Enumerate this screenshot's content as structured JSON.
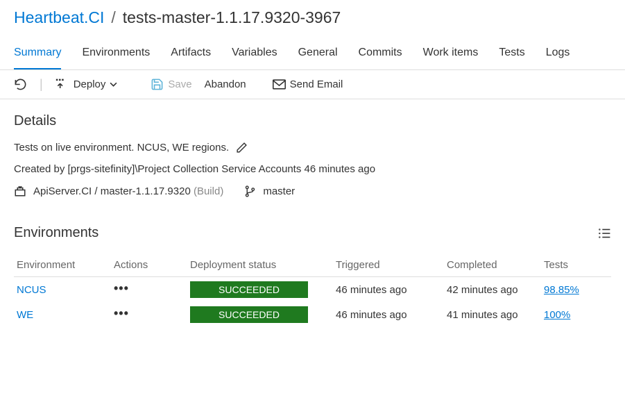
{
  "breadcrumb": {
    "pipeline": "Heartbeat.CI",
    "separator": "/",
    "release": "tests-master-1.1.17.9320-3967"
  },
  "tabs": [
    {
      "label": "Summary",
      "active": true
    },
    {
      "label": "Environments"
    },
    {
      "label": "Artifacts"
    },
    {
      "label": "Variables"
    },
    {
      "label": "General"
    },
    {
      "label": "Commits"
    },
    {
      "label": "Work items"
    },
    {
      "label": "Tests"
    },
    {
      "label": "Logs"
    }
  ],
  "toolbar": {
    "refresh": "",
    "deploy": "Deploy",
    "save": "Save",
    "abandon": "Abandon",
    "sendEmail": "Send Email"
  },
  "details": {
    "heading": "Details",
    "description": "Tests on live environment. NCUS, WE regions.",
    "createdByLine": "Created by [prgs-sitefinity]\\Project Collection Service Accounts 46 minutes ago",
    "build": {
      "pipeline": "ApiServer.CI",
      "sep": " / ",
      "name": "master-1.1.17.9320",
      "type": "(Build)"
    },
    "branch": "master"
  },
  "environments": {
    "heading": "Environments",
    "columns": {
      "env": "Environment",
      "actions": "Actions",
      "status": "Deployment status",
      "triggered": "Triggered",
      "completed": "Completed",
      "tests": "Tests"
    },
    "rows": [
      {
        "name": "NCUS",
        "status": "SUCCEEDED",
        "triggered": "46 minutes ago",
        "completed": "42 minutes ago",
        "tests": "98.85%"
      },
      {
        "name": "WE",
        "status": "SUCCEEDED",
        "triggered": "46 minutes ago",
        "completed": "41 minutes ago",
        "tests": "100%"
      }
    ]
  }
}
